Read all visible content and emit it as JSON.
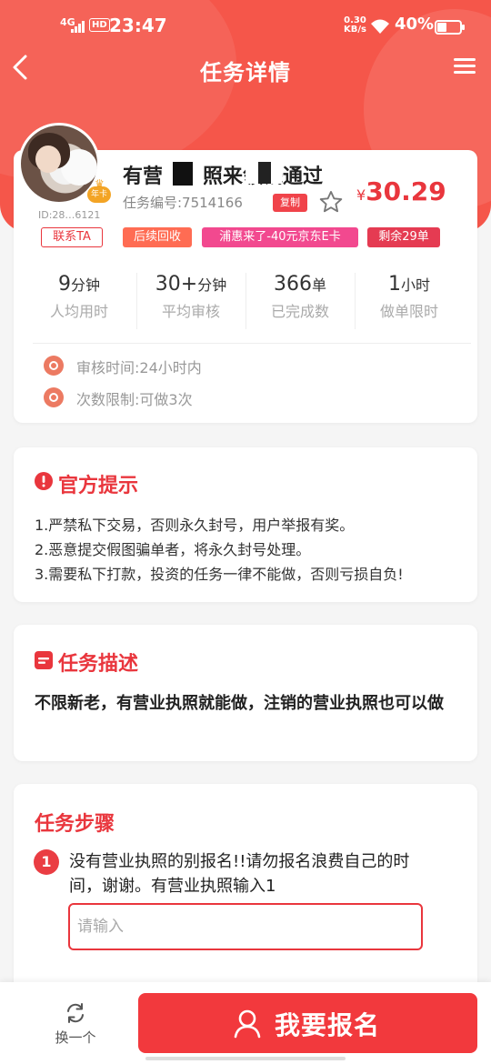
{
  "status_bar": {
    "network": "4G",
    "hd": "HD",
    "time": "23:47",
    "speed_value": "0.30",
    "speed_unit": "KB/s",
    "battery": "40%"
  },
  "nav": {
    "title": "任务详情",
    "back_icon": "chevron-left-icon",
    "menu_icon": "hamburger-menu-icon"
  },
  "publisher": {
    "vip_label": "年卡",
    "uid": "ID:28…6121"
  },
  "task": {
    "title": "有营业执照来领钱通过",
    "number": "任务编号:7514166",
    "copy_label": "复制",
    "price_currency": "¥",
    "price": "30.29",
    "tags": {
      "contact": "联系TA",
      "recycle": "后续回收",
      "promo": "浦惠来了-40元京东E卡",
      "remaining": "剩余29单"
    }
  },
  "stats": [
    {
      "value": "9",
      "unit": "分钟",
      "label": "人均用时"
    },
    {
      "value": "30+",
      "unit": "分钟",
      "label": "平均审核"
    },
    {
      "value": "366",
      "unit": "单",
      "label": "已完成数"
    },
    {
      "value": "1",
      "unit": "小时",
      "label": "做单限时"
    }
  ],
  "info": {
    "review_time": "审核时间:24小时内",
    "attempt_limit": "次数限制:可做3次"
  },
  "official_tips": {
    "title": "官方提示",
    "items": [
      "1.严禁私下交易，否则永久封号，用户举报有奖。",
      "2.恶意提交假图骗单者，将永久封号处理。",
      "3.需要私下打款，投资的任务一律不能做，否则亏损自负!"
    ]
  },
  "description": {
    "title": "任务描述",
    "text": "不限新老，有营业执照就能做，注销的营业执照也可以做"
  },
  "steps": {
    "title": "任务步骤",
    "items": [
      {
        "num": "1",
        "text": "没有营业执照的别报名!!请勿报名浪费自己的时间，谢谢。有营业执照输入1",
        "input_placeholder": "请输入",
        "input_value": ""
      }
    ]
  },
  "bottom": {
    "swap_label": "换一个",
    "apply_label": "我要报名"
  },
  "colors": {
    "brand": "#f5564a",
    "accent": "#e9363d",
    "promo": "#f2498f"
  }
}
